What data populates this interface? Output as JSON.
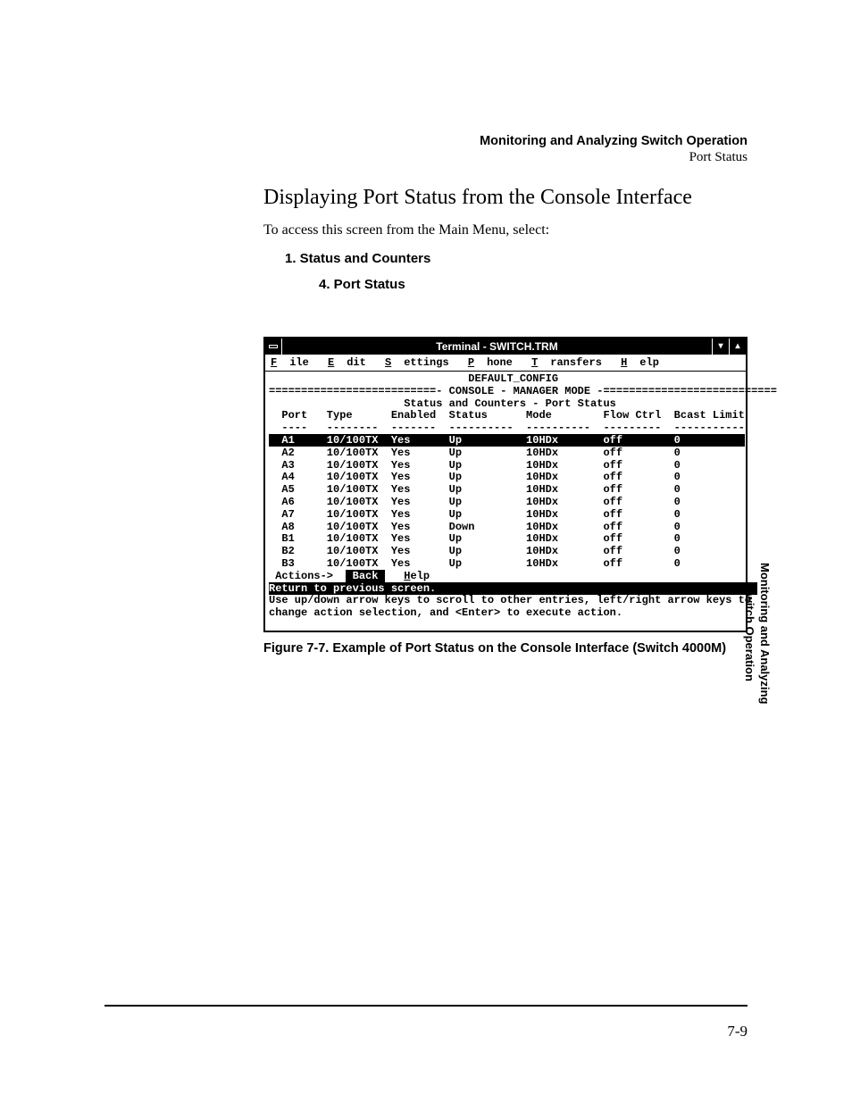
{
  "header": {
    "chapter": "Monitoring and Analyzing Switch Operation",
    "section": "Port Status"
  },
  "heading": "Displaying Port Status from the Console Interface",
  "intro": "To access this screen from the Main Menu, select:",
  "nav1": "1. Status and Counters",
  "nav2": "4. Port Status",
  "terminal": {
    "window_title": "Terminal - SWITCH.TRM",
    "menus": {
      "file": "File",
      "edit": "Edit",
      "settings": "Settings",
      "phone": "Phone",
      "transfers": "Transfers",
      "help": "Help"
    },
    "config_line": "DEFAULT_CONFIG",
    "mode_line": "==========================- CONSOLE - MANAGER MODE -===========================",
    "subtitle": "Status and Counters - Port Status",
    "columns": [
      "Port",
      "Type",
      "Enabled",
      "Status",
      "Mode",
      "Flow Ctrl",
      "Bcast Limit"
    ],
    "rows": [
      {
        "port": "A1",
        "type": "10/100TX",
        "enabled": "Yes",
        "status": "Up",
        "mode": "10HDx",
        "flow": "off",
        "bcast": "0",
        "highlight": true
      },
      {
        "port": "A2",
        "type": "10/100TX",
        "enabled": "Yes",
        "status": "Up",
        "mode": "10HDx",
        "flow": "off",
        "bcast": "0"
      },
      {
        "port": "A3",
        "type": "10/100TX",
        "enabled": "Yes",
        "status": "Up",
        "mode": "10HDx",
        "flow": "off",
        "bcast": "0"
      },
      {
        "port": "A4",
        "type": "10/100TX",
        "enabled": "Yes",
        "status": "Up",
        "mode": "10HDx",
        "flow": "off",
        "bcast": "0"
      },
      {
        "port": "A5",
        "type": "10/100TX",
        "enabled": "Yes",
        "status": "Up",
        "mode": "10HDx",
        "flow": "off",
        "bcast": "0"
      },
      {
        "port": "A6",
        "type": "10/100TX",
        "enabled": "Yes",
        "status": "Up",
        "mode": "10HDx",
        "flow": "off",
        "bcast": "0"
      },
      {
        "port": "A7",
        "type": "10/100TX",
        "enabled": "Yes",
        "status": "Up",
        "mode": "10HDx",
        "flow": "off",
        "bcast": "0"
      },
      {
        "port": "A8",
        "type": "10/100TX",
        "enabled": "Yes",
        "status": "Down",
        "mode": "10HDx",
        "flow": "off",
        "bcast": "0"
      },
      {
        "port": "B1",
        "type": "10/100TX",
        "enabled": "Yes",
        "status": "Up",
        "mode": "10HDx",
        "flow": "off",
        "bcast": "0"
      },
      {
        "port": "B2",
        "type": "10/100TX",
        "enabled": "Yes",
        "status": "Up",
        "mode": "10HDx",
        "flow": "off",
        "bcast": "0"
      },
      {
        "port": "B3",
        "type": "10/100TX",
        "enabled": "Yes",
        "status": "Up",
        "mode": "10HDx",
        "flow": "off",
        "bcast": "0"
      }
    ],
    "actions_label": "Actions->",
    "actions": {
      "back": "Back",
      "help": "Help"
    },
    "statusbar": "Return to previous screen.",
    "hint1": "Use up/down arrow keys to scroll to other entries, left/right arrow keys to",
    "hint2": "change action selection, and <Enter> to execute action."
  },
  "figure_caption": "Figure 7-7.   Example of Port Status on the Console Interface (Switch 4000M)",
  "sidetab": {
    "line1": "Monitoring and Analyzing",
    "line2": "Switch Operation"
  },
  "page_number": "7-9"
}
